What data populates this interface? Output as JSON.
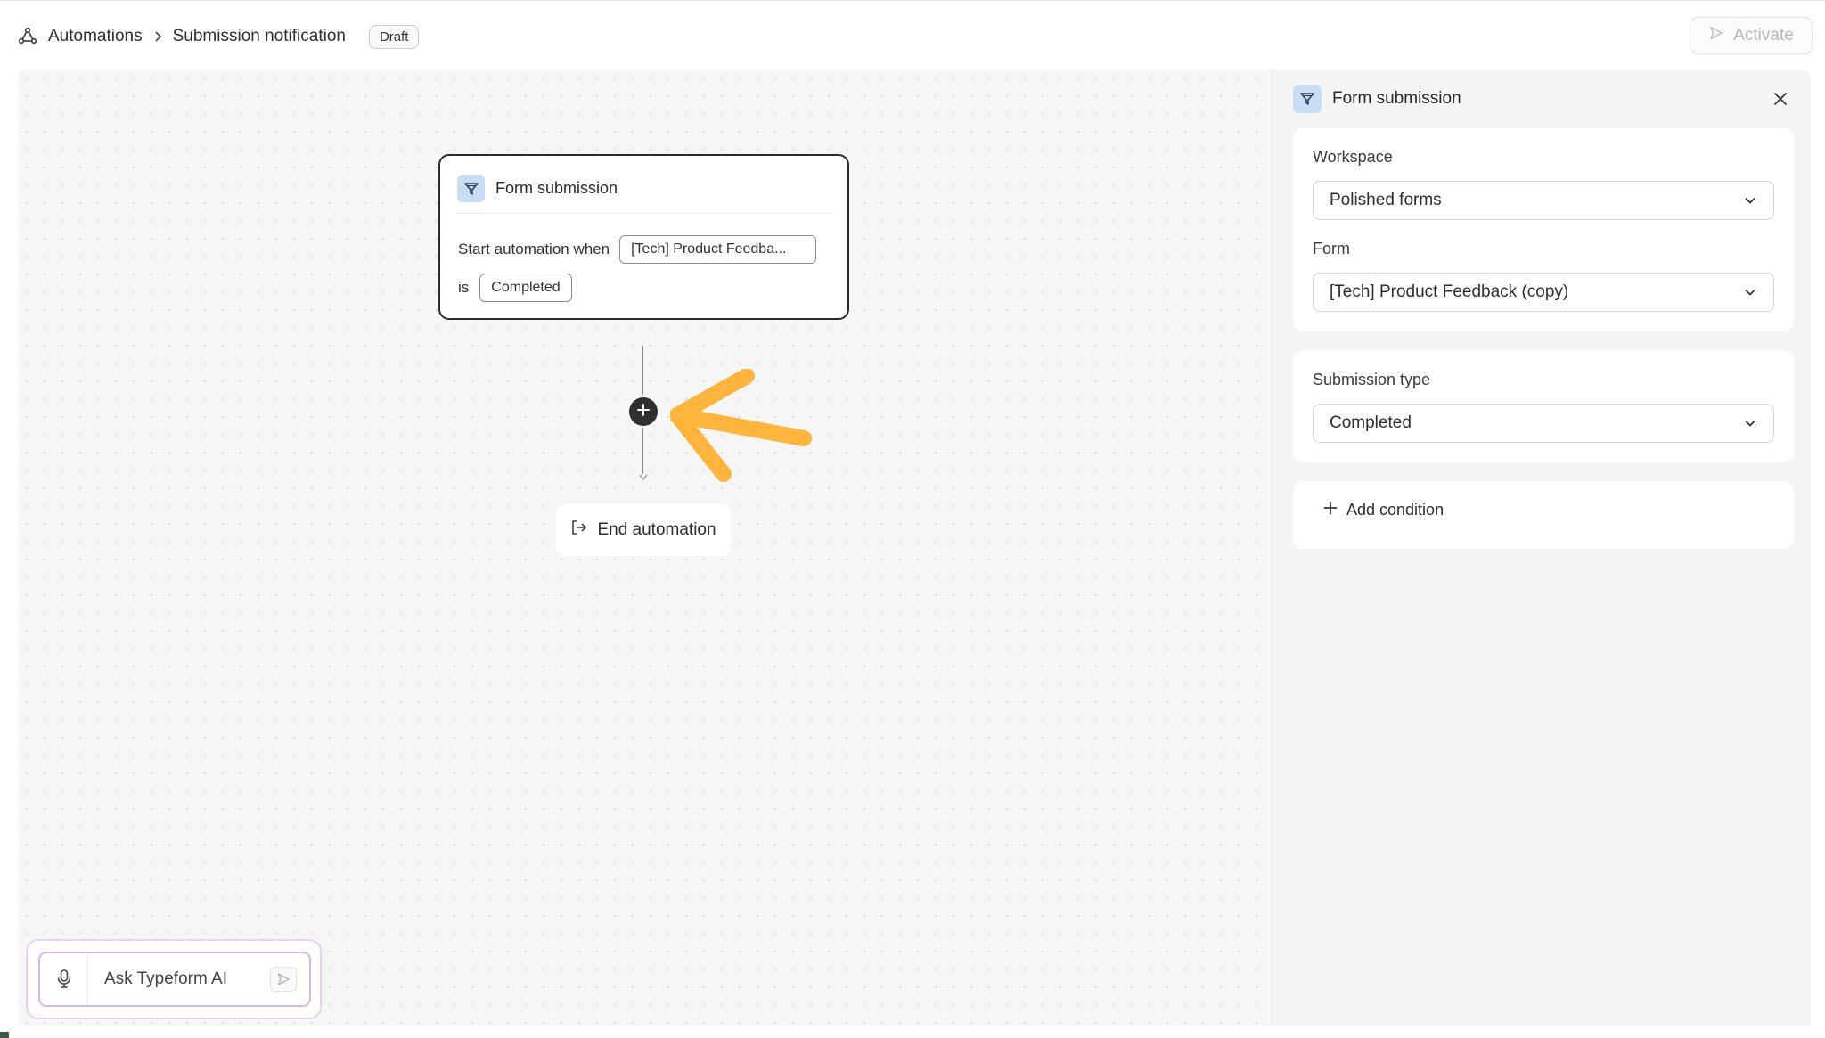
{
  "breadcrumb": {
    "root": "Automations",
    "current": "Submission notification",
    "status_badge": "Draft",
    "icons": {
      "root": "automation-icon",
      "separator": "chevron-right-icon"
    }
  },
  "toolbar": {
    "activate_label": "Activate",
    "activate_icon": "play-icon"
  },
  "flow": {
    "trigger_node": {
      "title": "Form submission",
      "icon": "typeform-submit-icon",
      "start_text": "Start automation when",
      "form_chip": "[Tech] Product Feedba...",
      "is_text": "is",
      "status_chip": "Completed"
    },
    "add_step_icon": "plus-icon",
    "end_node": {
      "label": "End automation",
      "icon": "exit-icon"
    }
  },
  "panel": {
    "title": "Form submission",
    "close_icon": "close-icon",
    "workspace": {
      "label": "Workspace",
      "value": "Polished forms"
    },
    "form": {
      "label": "Form",
      "value": "[Tech] Product Feedback (copy)"
    },
    "submission_type": {
      "label": "Submission type",
      "value": "Completed"
    },
    "add_condition_label": "Add condition"
  },
  "ai": {
    "placeholder": "Ask Typeform AI",
    "mic_icon": "microphone-icon",
    "send_icon": "send-icon"
  },
  "colors": {
    "accent_arrow": "#FFB43B",
    "icon_bg": "#C7DCF5",
    "ai_border": "#D7B6EA",
    "canvas_bg": "#F6F6F6"
  }
}
